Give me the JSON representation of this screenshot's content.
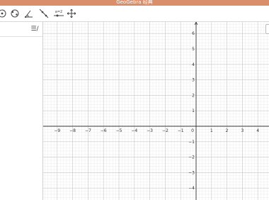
{
  "app": {
    "title": "GeoGebra 经典"
  },
  "toolbar": {
    "tools": [
      {
        "name": "move-tool",
        "icon": "point-icon"
      },
      {
        "name": "point-tool",
        "icon": "point-icon"
      },
      {
        "name": "circle-tool",
        "icon": "circle-points-icon"
      },
      {
        "name": "angle-tool",
        "icon": "angle-icon"
      },
      {
        "name": "line-tool",
        "icon": "line-icon"
      },
      {
        "name": "slider-tool",
        "icon": "slider-icon",
        "label": "a=2"
      },
      {
        "name": "move-view-tool",
        "icon": "move-cross-icon"
      }
    ]
  },
  "algebra": {
    "menu_label": "☰/"
  },
  "graphics": {
    "x_ticks": [
      "−9",
      "−8",
      "−7",
      "−6",
      "−5",
      "−4",
      "−3",
      "−2",
      "−1",
      "0",
      "1",
      "2",
      "3",
      "4"
    ],
    "y_ticks_pos": [
      "6",
      "5",
      "4",
      "3",
      "2",
      "1"
    ],
    "y_ticks_neg": [
      "−1",
      "−2",
      "−3",
      "−4"
    ],
    "colors": {
      "grid_minor": "#ececec",
      "grid_major": "#c9c9c9",
      "axis": "#333333"
    }
  }
}
